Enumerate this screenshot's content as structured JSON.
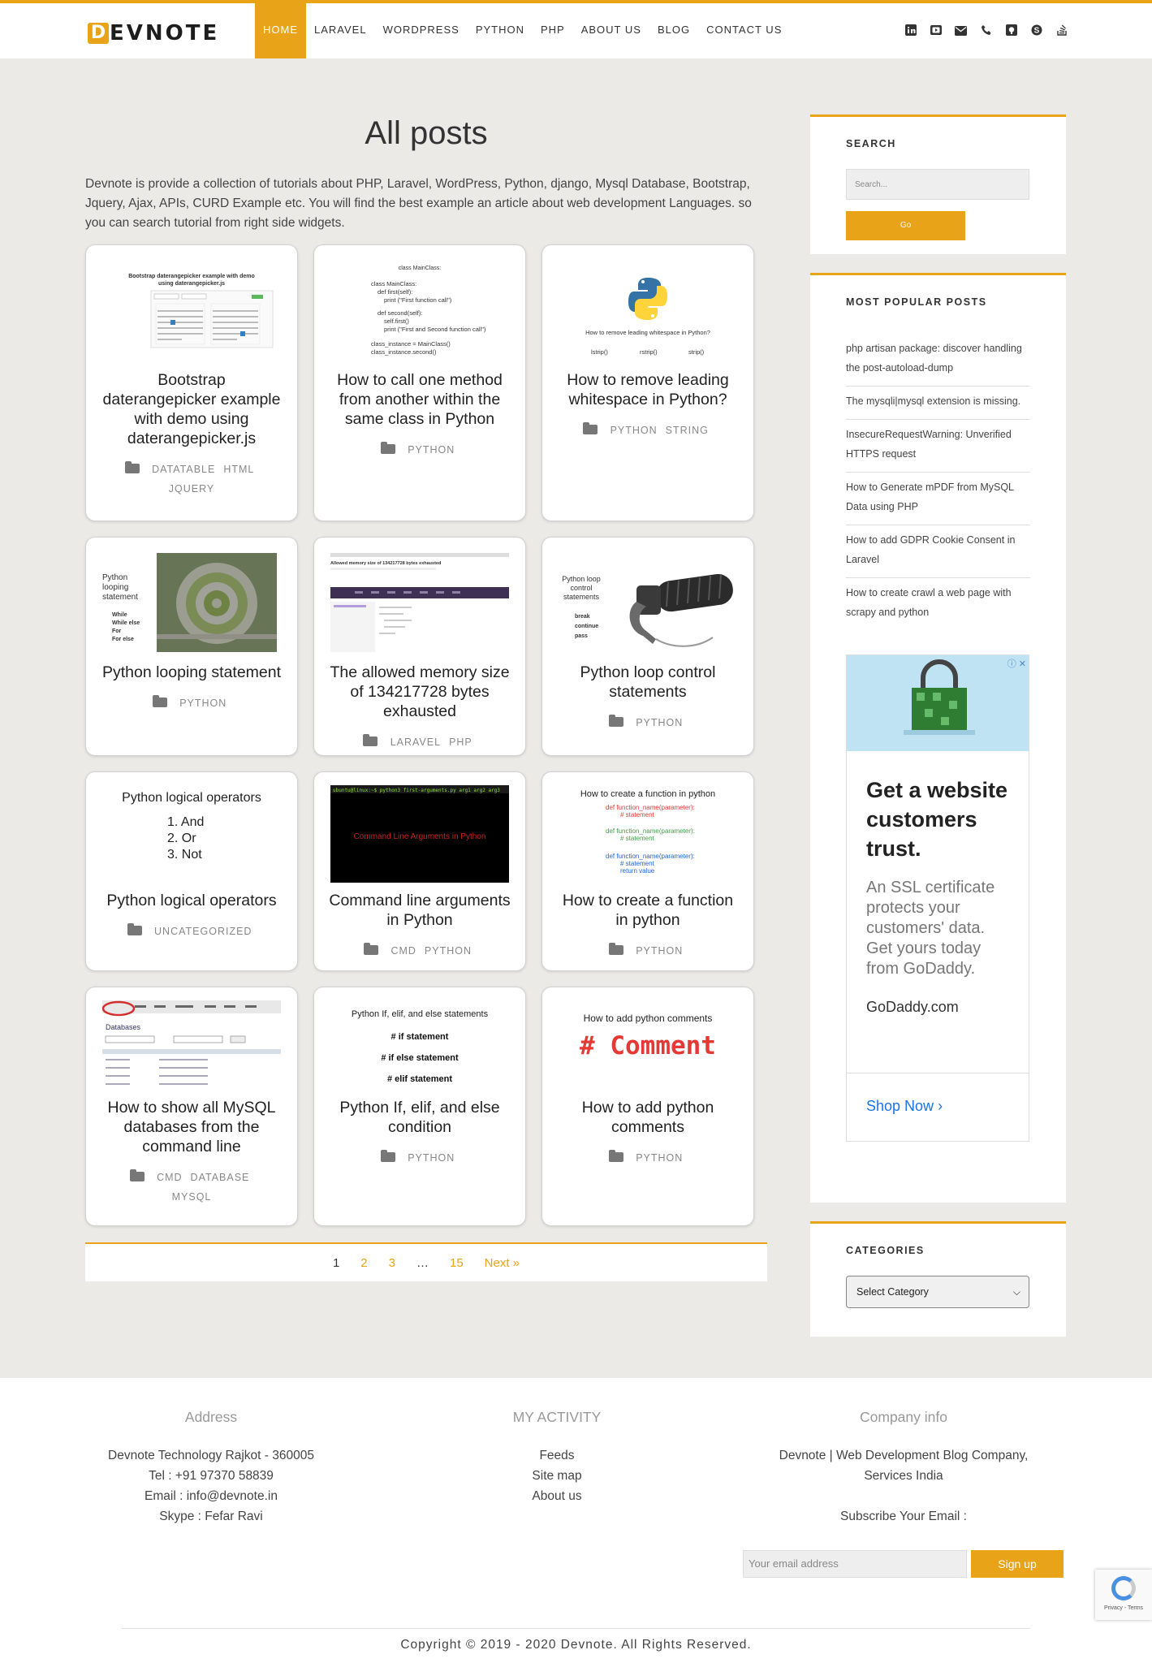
{
  "brand": {
    "mark": "D",
    "name": "EVNOTE"
  },
  "nav": [
    "HOME",
    "LARAVEL",
    "WORDPRESS",
    "PYTHON",
    "PHP",
    "ABOUT US",
    "BLOG",
    "CONTACT US"
  ],
  "social_icons": [
    "linkedin-icon",
    "youtube-icon",
    "mail-icon",
    "phone-icon",
    "github-icon",
    "skype-icon",
    "stackoverflow-icon"
  ],
  "main": {
    "title": "All posts",
    "intro": "Devnote is provide a collection of tutorials about PHP, Laravel, WordPress, Python, django, Mysql Database, Bootstrap, Jquery, Ajax, APIs, CURD Example etc. You will find the best example an article about web development Languages. so you can search tutorial from right side widgets."
  },
  "cards": [
    {
      "title": "Bootstrap daterangepicker example with demo using daterangepicker.js",
      "tags": [
        "DATATABLE",
        "HTML",
        "JQUERY"
      ],
      "img_text": "Bootstrap daterangepicker example with demo using daterangepicker.js"
    },
    {
      "title": "How to call one method from another within the same class in Python",
      "tags": [
        "PYTHON"
      ],
      "img_text": "How to call one method from another within same class in Python"
    },
    {
      "title": "How to remove leading whitespace in Python?",
      "tags": [
        "PYTHON",
        "STRING"
      ],
      "img_text": "How to remove leading whitespace in Python?"
    },
    {
      "title": "Python looping statement",
      "tags": [
        "PYTHON"
      ],
      "img_text": "Python looping statement"
    },
    {
      "title": "The allowed memory size of 134217728 bytes exhausted",
      "tags": [
        "LARAVEL",
        "PHP"
      ],
      "img_text": "Allowed memory size of 134217728 bytes exhausted"
    },
    {
      "title": "Python loop control statements",
      "tags": [
        "PYTHON"
      ],
      "img_text": "Python loop control statements"
    },
    {
      "title": "Python logical operators",
      "tags": [
        "UNCATEGORIZED"
      ],
      "img_text": "Python logical operators"
    },
    {
      "title": "Command line arguments in Python",
      "tags": [
        "CMD",
        "PYTHON"
      ],
      "img_text": "Command Line Arguments in Python"
    },
    {
      "title": "How to create a function in python",
      "tags": [
        "PYTHON"
      ],
      "img_text": "How to create a function in python"
    },
    {
      "title": "How to show all MySQL databases from the command line",
      "tags": [
        "CMD",
        "DATABASE",
        "MYSQL"
      ],
      "img_text": "Databases"
    },
    {
      "title": "Python If, elif, and else condition",
      "tags": [
        "PYTHON"
      ],
      "img_text": "Python If, elif, and else statements"
    },
    {
      "title": "How to add python comments",
      "tags": [
        "PYTHON"
      ],
      "img_text": "How to add python comments"
    }
  ],
  "img_extra": {
    "c2_code": [
      "class MainClass:",
      "def first(self):",
      "print (\"First function call\")",
      "def second(self):",
      "self.first()",
      "print (\"First and Second function call\")",
      "class_instance = MainClass()",
      "class_instance.second()"
    ],
    "c3_methods": [
      "lstrip()",
      "rstrip()",
      "strip()"
    ],
    "c4_list": [
      "While",
      "While else",
      "For",
      "For else"
    ],
    "c6_list": [
      "break",
      "continue",
      "pass"
    ],
    "c7_list": [
      "1. And",
      "2. Or",
      "3. Not"
    ],
    "c8_prompt": "ubuntu@linux:~$ python3 first-arguments.py arg1 arg2 arg3",
    "c9_code": [
      "def function_name(parameter):",
      "# statement",
      "def function_name(parameter):",
      "# statement",
      "def function_name(parameter):",
      "# statement",
      "return value"
    ],
    "c11_list": [
      "# if statement",
      "# if else statement",
      "# elif statement"
    ],
    "c12_big": "# Comment"
  },
  "pagination": [
    "1",
    "2",
    "3",
    "…",
    "15",
    "Next »"
  ],
  "sidebar": {
    "search_title": "SEARCH",
    "search_placeholder": "Search...",
    "go_label": "Go",
    "popular_title": "MOST POPULAR POSTS",
    "popular": [
      "php artisan package: discover handling the post-autoload-dump",
      "The mysqli|mysql extension is missing.",
      "InsecureRequestWarning: Unverified HTTPS request",
      "How to Generate mPDF from MySQL Data using PHP",
      "How to add GDPR Cookie Consent in Laravel",
      "How to create crawl a web page with scrapy and python"
    ],
    "ad": {
      "headline": "Get a website customers trust.",
      "copy": "An SSL certificate protects your customers' data. Get yours today from GoDaddy.",
      "brand": "GoDaddy.com",
      "cta": "Shop Now"
    },
    "categories_title": "CATEGORIES",
    "categories_selected": "Select Category"
  },
  "footer": {
    "address_title": "Address",
    "address_lines": [
      "Devnote Technology Rajkot - 360005",
      "Tel : +91 97370 58839",
      "Email : info@devnote.in",
      "Skype : Fefar Ravi"
    ],
    "activity_title": "MY ACTIVITY",
    "activity_links": [
      "Feeds",
      "Site map",
      "About us"
    ],
    "company_title": "Company info",
    "company_lines": [
      "Devnote | Web Development Blog Company,",
      "Services India"
    ],
    "subscribe_label": "Subscribe Your Email :",
    "email_placeholder": "Your email address",
    "signup_label": "Sign up",
    "copyright": "Copyright © 2019 - 2020 Devnote. All Rights Reserved."
  },
  "recaptcha_text": "Privacy - Terms",
  "colors": {
    "accent": "#e8a319",
    "background": "#ebeae6"
  }
}
